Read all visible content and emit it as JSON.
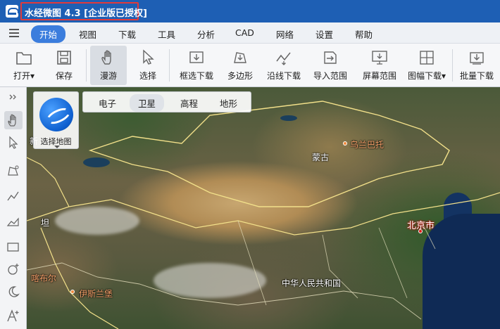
{
  "window": {
    "title": "水经微图 4.3 [企业版已授权]"
  },
  "menu": {
    "items": [
      {
        "label": "开始",
        "active": true
      },
      {
        "label": "视图"
      },
      {
        "label": "下载"
      },
      {
        "label": "工具"
      },
      {
        "label": "分析"
      },
      {
        "label": "CAD"
      },
      {
        "label": "网络"
      },
      {
        "label": "设置"
      },
      {
        "label": "帮助"
      }
    ]
  },
  "toolbar": {
    "open": "打开",
    "open_caret": "▾",
    "save": "保存",
    "pan": "漫游",
    "select": "选择",
    "box_download": "框选下载",
    "polygon": "多边形",
    "line_download": "沿线下载",
    "import_range": "导入范围",
    "screen_range": "屏幕范围",
    "sheet_download": "图幅下载",
    "sheet_caret": "▾",
    "batch_download": "批量下载"
  },
  "map_selector": {
    "label": "选择地图",
    "types": [
      "电子",
      "卫星",
      "高程",
      "地形"
    ],
    "active": "卫星"
  },
  "places": {
    "ulaanbaatar": "乌兰巴托",
    "mongolia": "蒙古",
    "beijing": "北京市",
    "china": "中华人民共和国",
    "kabul": "喀布尔",
    "islamabad": "伊斯兰堡",
    "tan": "坦",
    "xin": "新"
  },
  "colors": {
    "title_bar": "#1e5fb4",
    "active_pill": "#3b7ddd",
    "highlight_box": "#e23a3a",
    "border_line": "#f2e08a"
  }
}
